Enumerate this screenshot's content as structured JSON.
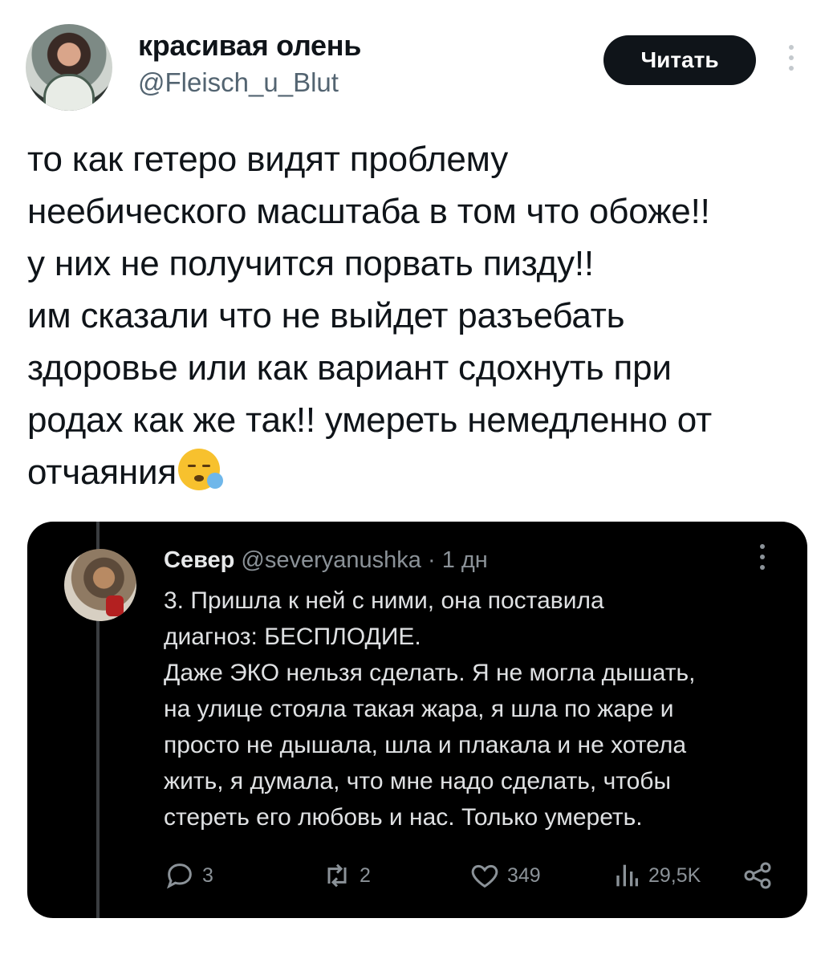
{
  "author": {
    "display_name": "красивая олень",
    "handle": "@Fleisch_u_Blut",
    "follow_label": "Читать"
  },
  "tweet": {
    "lines": [
      "то как гетеро видят проблему",
      "неебического масштаба в том что обоже!!",
      "у них не получится порвать пизду!!",
      "им сказали что не выйдет разъебать",
      "здоровье или как вариант сдохнуть при",
      "родах как же так!! умереть немедленно от",
      "отчаяния"
    ],
    "emoji": "sleepy-face-emoji"
  },
  "quoted": {
    "name": "Север",
    "handle": "@severyanushka",
    "time": "· 1 дн",
    "lines": [
      "3. Пришла к ней с ними, она поставила",
      "диагноз: БЕСПЛОДИЕ.",
      "Даже ЭКО нельзя сделать. Я не могла дышать,",
      "на улице стояла такая жара, я шла по жаре и",
      "просто не дышала, шла и плакала и не хотела",
      "жить, я думала, что мне надо сделать, чтобы",
      "стереть его любовь и нас. Только умереть."
    ],
    "actions": {
      "replies": "3",
      "retweets": "2",
      "likes": "349",
      "views": "29,5K"
    }
  }
}
